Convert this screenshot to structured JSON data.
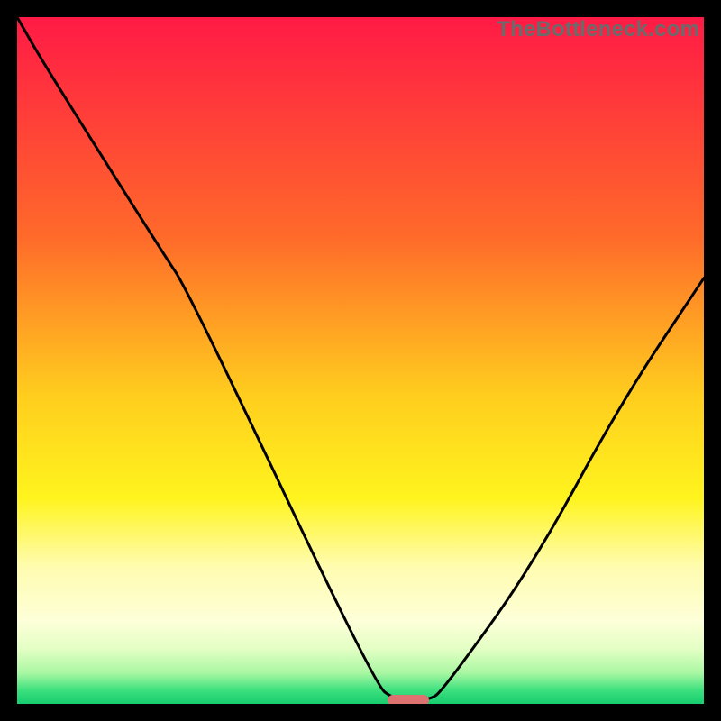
{
  "watermark": {
    "text": "TheBottleneck.com"
  },
  "chart_data": {
    "type": "line",
    "title": "",
    "xlabel": "",
    "ylabel": "",
    "xlim": [
      0,
      100
    ],
    "ylim": [
      0,
      100
    ],
    "gradient_stops": [
      {
        "offset": 0,
        "color": "#ff1a45"
      },
      {
        "offset": 0.32,
        "color": "#ff6a2a"
      },
      {
        "offset": 0.55,
        "color": "#ffcd1e"
      },
      {
        "offset": 0.7,
        "color": "#fff41e"
      },
      {
        "offset": 0.8,
        "color": "#fffcb0"
      },
      {
        "offset": 0.88,
        "color": "#fdffd8"
      },
      {
        "offset": 0.92,
        "color": "#e3ffc4"
      },
      {
        "offset": 0.955,
        "color": "#a9f7a2"
      },
      {
        "offset": 0.98,
        "color": "#3de07e"
      },
      {
        "offset": 1.0,
        "color": "#16cd6f"
      }
    ],
    "series": [
      {
        "name": "bottleneck-curve",
        "points": [
          {
            "x": 0,
            "y": 100
          },
          {
            "x": 4,
            "y": 93
          },
          {
            "x": 21,
            "y": 66
          },
          {
            "x": 25,
            "y": 60
          },
          {
            "x": 52,
            "y": 3
          },
          {
            "x": 55,
            "y": 0.5
          },
          {
            "x": 60,
            "y": 0.5
          },
          {
            "x": 62,
            "y": 2
          },
          {
            "x": 75,
            "y": 20
          },
          {
            "x": 88,
            "y": 44
          },
          {
            "x": 100,
            "y": 62
          }
        ]
      }
    ],
    "marker": {
      "x": 57,
      "y": 0.5,
      "width_pct": 6,
      "height_pct": 1.6,
      "color": "#de7270"
    }
  }
}
